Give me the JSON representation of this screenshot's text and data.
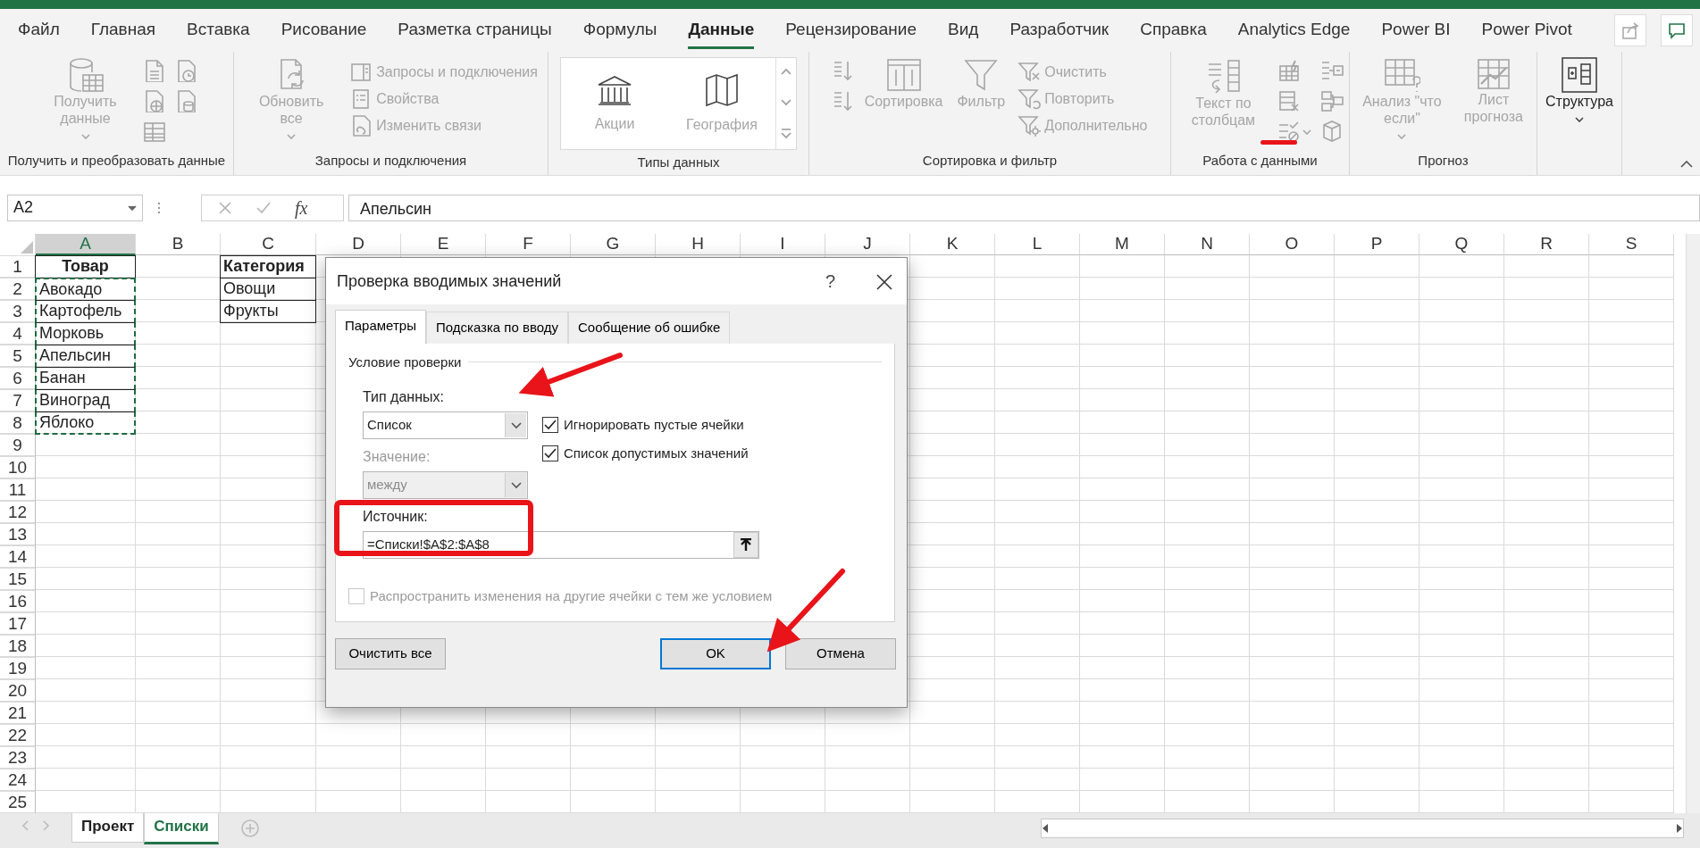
{
  "ribbon_tabs": [
    {
      "label": "Файл",
      "selected": false
    },
    {
      "label": "Главная",
      "selected": false
    },
    {
      "label": "Вставка",
      "selected": false
    },
    {
      "label": "Рисование",
      "selected": false
    },
    {
      "label": "Разметка страницы",
      "selected": false
    },
    {
      "label": "Формулы",
      "selected": false
    },
    {
      "label": "Данные",
      "selected": true
    },
    {
      "label": "Рецензирование",
      "selected": false
    },
    {
      "label": "Вид",
      "selected": false
    },
    {
      "label": "Разработчик",
      "selected": false
    },
    {
      "label": "Справка",
      "selected": false
    },
    {
      "label": "Analytics Edge",
      "selected": false
    },
    {
      "label": "Power BI",
      "selected": false
    },
    {
      "label": "Power Pivot",
      "selected": false
    }
  ],
  "ribbon_groups": [
    {
      "label": "Получить и преобразовать данные",
      "items": [
        {
          "kind": "large",
          "label": "Получить данные",
          "dropdown": true,
          "disabled": true
        },
        {
          "kind": "icon",
          "disabled": true
        },
        {
          "kind": "icon",
          "disabled": true
        },
        {
          "kind": "icon",
          "disabled": true
        },
        {
          "kind": "icon",
          "disabled": true
        },
        {
          "kind": "icon",
          "disabled": true
        }
      ]
    },
    {
      "label": "Запросы и подключения",
      "items": [
        {
          "kind": "large",
          "label": "Обновить все",
          "dropdown": true,
          "disabled": true
        },
        {
          "kind": "small",
          "label": "Запросы и подключения",
          "disabled": true
        },
        {
          "kind": "small",
          "label": "Свойства",
          "disabled": true
        },
        {
          "kind": "small",
          "label": "Изменить связи",
          "disabled": true
        }
      ]
    },
    {
      "label": "Типы данных",
      "items": [
        {
          "kind": "gallery",
          "options": [
            {
              "label": "Акции",
              "disabled": true
            },
            {
              "label": "География",
              "disabled": true
            }
          ]
        }
      ]
    },
    {
      "label": "Сортировка и фильтр",
      "items": [
        {
          "kind": "icon",
          "disabled": true
        },
        {
          "kind": "icon",
          "disabled": true
        },
        {
          "kind": "large",
          "label": "Сортировка",
          "disabled": true
        },
        {
          "kind": "large",
          "label": "Фильтр",
          "disabled": true
        },
        {
          "kind": "small",
          "label": "Очистить",
          "disabled": true
        },
        {
          "kind": "small",
          "label": "Повторить",
          "disabled": true
        },
        {
          "kind": "small",
          "label": "Дополнительно",
          "disabled": true
        }
      ]
    },
    {
      "label": "Работа с данными",
      "items": [
        {
          "kind": "large",
          "label": "Текст по столбцам",
          "disabled": true
        },
        {
          "kind": "icon",
          "disabled": true
        },
        {
          "kind": "icon",
          "disabled": true
        },
        {
          "kind": "icon",
          "disabled": true,
          "dropdown": true
        },
        {
          "kind": "icon",
          "disabled": true
        },
        {
          "kind": "icon",
          "disabled": true
        },
        {
          "kind": "icon",
          "disabled": true
        }
      ]
    },
    {
      "label": "Прогноз",
      "items": [
        {
          "kind": "large",
          "label": "Анализ \"что если\"",
          "dropdown": true,
          "disabled": true
        },
        {
          "kind": "large",
          "label": "Лист прогноза",
          "disabled": true
        }
      ]
    },
    {
      "items": [
        {
          "kind": "large",
          "label": "Структура",
          "dropdown": true,
          "disabled": false
        }
      ]
    }
  ],
  "formula_bar": {
    "name_box": "A2",
    "function_label": "fx",
    "value": "Апельсин"
  },
  "sheet": {
    "columns": [
      {
        "label": "A",
        "selected": true
      },
      {
        "label": "B",
        "selected": false
      },
      {
        "label": "C",
        "selected": false
      },
      {
        "label": "D",
        "selected": false
      },
      {
        "label": "E",
        "selected": false
      },
      {
        "label": "F",
        "selected": false
      },
      {
        "label": "G",
        "selected": false
      },
      {
        "label": "H",
        "selected": false
      },
      {
        "label": "I",
        "selected": false
      },
      {
        "label": "J",
        "selected": false
      },
      {
        "label": "K",
        "selected": false
      },
      {
        "label": "L",
        "selected": false
      },
      {
        "label": "M",
        "selected": false
      },
      {
        "label": "N",
        "selected": false
      },
      {
        "label": "O",
        "selected": false
      },
      {
        "label": "P",
        "selected": false
      },
      {
        "label": "Q",
        "selected": false
      },
      {
        "label": "R",
        "selected": false
      },
      {
        "label": "S",
        "selected": false
      }
    ],
    "rows": [
      {
        "label": "1",
        "cells": [
          {
            "text": "Товар",
            "bold": true,
            "centered": true,
            "bordered": true
          },
          {},
          {
            "text": "Категория",
            "bold": true,
            "bordered": true
          }
        ]
      },
      {
        "label": "2",
        "cells": [
          {
            "text": "Авокадо",
            "bordered": true,
            "marquee": true
          },
          {},
          {
            "text": "Овощи",
            "bordered": true
          }
        ]
      },
      {
        "label": "3",
        "cells": [
          {
            "text": "Картофель",
            "bordered": true,
            "marquee": true
          },
          {},
          {
            "text": "Фрукты",
            "bordered": true
          }
        ]
      },
      {
        "label": "4",
        "cells": [
          {
            "text": "Морковь",
            "bordered": true,
            "marquee": true
          }
        ]
      },
      {
        "label": "5",
        "cells": [
          {
            "text": "Апельсин",
            "bordered": true,
            "marquee": true
          }
        ]
      },
      {
        "label": "6",
        "cells": [
          {
            "text": "Банан",
            "bordered": true,
            "marquee": true
          }
        ]
      },
      {
        "label": "7",
        "cells": [
          {
            "text": "Виноград",
            "bordered": true,
            "marquee": true
          }
        ]
      },
      {
        "label": "8",
        "cells": [
          {
            "text": "Яблоко",
            "bordered": true,
            "marquee": true
          }
        ]
      },
      {
        "label": "9"
      },
      {
        "label": "10"
      },
      {
        "label": "11"
      },
      {
        "label": "12"
      },
      {
        "label": "13"
      },
      {
        "label": "14"
      },
      {
        "label": "15"
      },
      {
        "label": "16"
      },
      {
        "label": "17"
      },
      {
        "label": "18"
      },
      {
        "label": "19"
      },
      {
        "label": "20"
      },
      {
        "label": "21"
      },
      {
        "label": "22"
      },
      {
        "label": "23"
      },
      {
        "label": "24"
      },
      {
        "label": "25"
      }
    ]
  },
  "sheet_tabs": [
    {
      "label": "Проект",
      "selected": false
    },
    {
      "label": "Списки",
      "selected": true
    }
  ],
  "dialog": {
    "title": "Проверка вводимых значений",
    "help": "?",
    "tabs": [
      {
        "label": "Параметры",
        "selected": true
      },
      {
        "label": "Подсказка по вводу",
        "selected": false
      },
      {
        "label": "Сообщение об ошибке",
        "selected": false
      }
    ],
    "section": "Условие проверки",
    "allow_label": "Тип данных:",
    "allow_value": "Список",
    "data_label": "Значение:",
    "data_value": "между",
    "data_disabled": true,
    "checkboxes": [
      {
        "label": "Игнорировать пустые ячейки",
        "checked": true
      },
      {
        "label": "Список допустимых значений",
        "checked": true
      }
    ],
    "source_label": "Источник:",
    "source_value": "=Списки!$A$2:$A$8",
    "apply_all": {
      "label": "Распространить изменения на другие ячейки с тем же условием",
      "checked": false,
      "disabled": true
    },
    "buttons": [
      {
        "label": "Очистить все",
        "default": false
      },
      {
        "label": "OK",
        "default": true
      },
      {
        "label": "Отмена",
        "default": false
      }
    ]
  }
}
